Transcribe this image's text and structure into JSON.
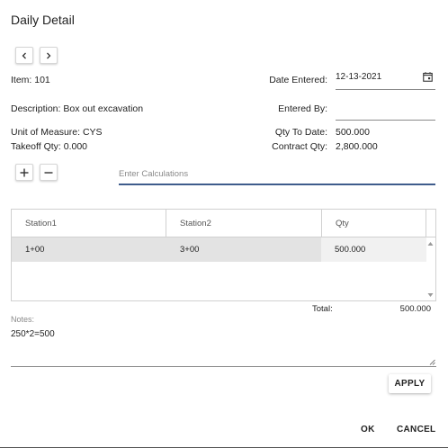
{
  "dialog": {
    "title": "Daily Detail"
  },
  "nav": {
    "prev_icon": "chevron-left-icon",
    "next_icon": "chevron-right-icon"
  },
  "item": {
    "item_text": "Item: 101",
    "description_text": "Description: Box out excavation",
    "unit_text": "Unit of Measure: CYS",
    "takeoff_text": "Takeoff Qty: 0.000"
  },
  "fields": {
    "date_entered_label": "Date Entered:",
    "date_entered_value": "12-13-2021",
    "entered_by_label": "Entered By:",
    "entered_by_value": "",
    "qty_to_date_label": "Qty To Date:",
    "qty_to_date_value": "500.000",
    "contract_qty_label": "Contract Qty:",
    "contract_qty_value": "2,800.000"
  },
  "calc": {
    "add_icon": "plus-icon",
    "remove_icon": "minus-icon",
    "placeholder": "Enter Calculations",
    "value": ""
  },
  "grid": {
    "columns": [
      "Station1",
      "Station2",
      "Qty"
    ],
    "rows": [
      {
        "station1": "1+00",
        "station2": "3+00",
        "qty": "500.000"
      }
    ],
    "total_label": "Total:",
    "total_value": "500.000"
  },
  "notes": {
    "label": "Notes:",
    "value": "250*2=500"
  },
  "actions": {
    "apply": "APPLY",
    "ok": "OK",
    "cancel": "CANCEL"
  },
  "colors": {
    "accent": "#3f5c8c",
    "selected_row": "#e3e3e3"
  }
}
